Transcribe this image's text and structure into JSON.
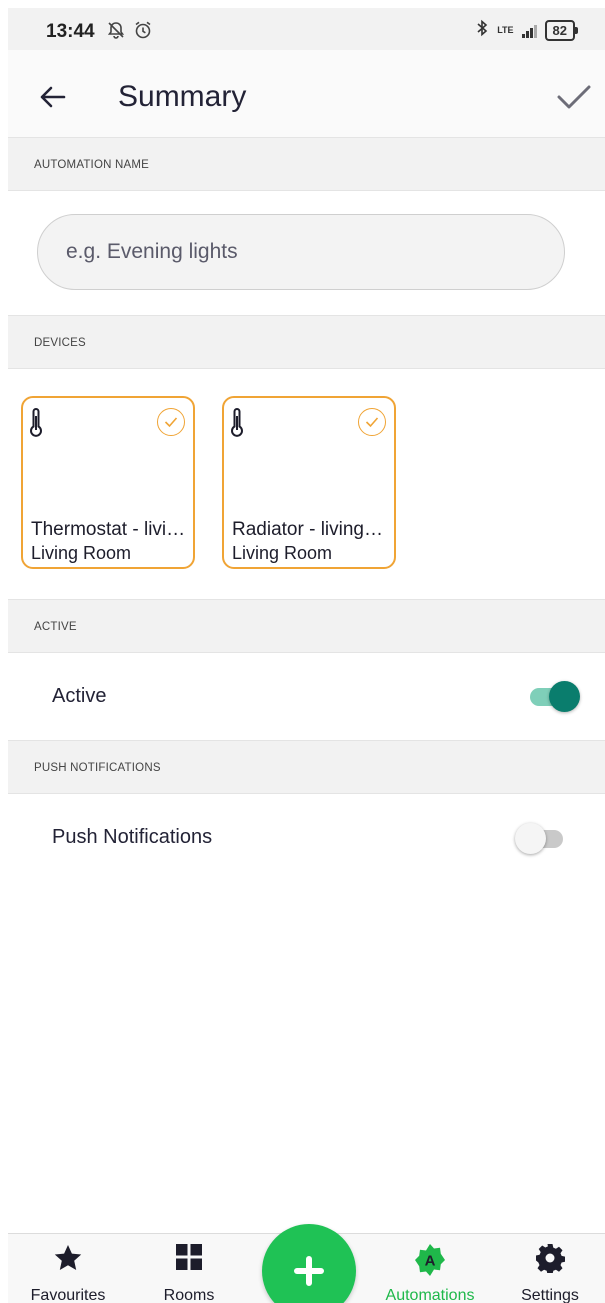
{
  "status_bar": {
    "time": "13:44",
    "battery": "82",
    "network": "LTE"
  },
  "header": {
    "title": "Summary"
  },
  "sections": {
    "automation_name": "AUTOMATION NAME",
    "devices": "DEVICES",
    "active": "ACTIVE",
    "push": "PUSH NOTIFICATIONS"
  },
  "name_input": {
    "placeholder": "e.g. Evening lights",
    "value": ""
  },
  "devices": [
    {
      "name": "Thermostat - livi…",
      "room": "Living Room",
      "icon": "thermometer-icon",
      "selected": true
    },
    {
      "name": "Radiator - living…",
      "room": "Living Room",
      "icon": "thermometer-icon",
      "selected": true
    }
  ],
  "active_row": {
    "label": "Active",
    "on": true
  },
  "push_row": {
    "label": "Push Notifications",
    "on": false
  },
  "nav": {
    "favourites": "Favourites",
    "rooms": "Rooms",
    "automations": "Automations",
    "settings": "Settings"
  },
  "colors": {
    "accent_orange": "#f0a435",
    "toggle_on": "#0a7d6d",
    "fab_green": "#1fc255",
    "active_nav": "#1fb84a"
  }
}
